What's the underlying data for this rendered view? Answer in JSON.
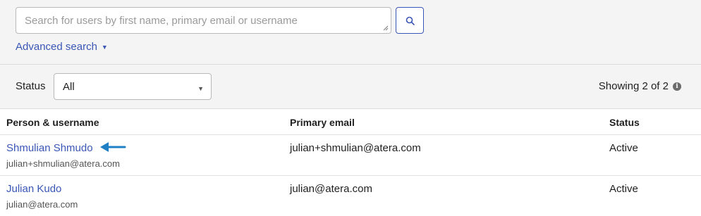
{
  "search": {
    "placeholder": "Search for users by first name, primary email or username",
    "advanced_label": "Advanced search",
    "advanced_caret": "▼"
  },
  "filter": {
    "status_label": "Status",
    "status_value": "All",
    "status_arrow": "▼",
    "showing_text": "Showing 2 of 2",
    "info_glyph": "i"
  },
  "table": {
    "headers": [
      "Person & username",
      "Primary email",
      "Status"
    ],
    "rows": [
      {
        "name": "Shmulian Shmudo",
        "username": "julian+shmulian@atera.com",
        "email": "julian+shmulian@atera.com",
        "status": "Active"
      },
      {
        "name": "Julian Kudo",
        "username": "julian@atera.com",
        "email": "julian@atera.com",
        "status": "Active"
      }
    ]
  },
  "colors": {
    "accent": "#3a56b5",
    "pointer_arrow": "#1f7fc4"
  },
  "icons": {
    "search_button": "magnifier-icon",
    "info": "info-icon",
    "pointer": "arrow-left-icon"
  }
}
